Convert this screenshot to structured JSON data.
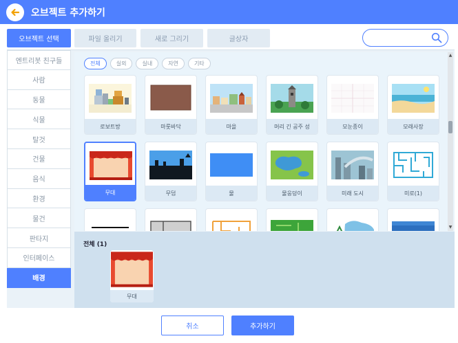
{
  "header": {
    "title": "오브젝트 추가하기"
  },
  "tabs": [
    {
      "label": "오브젝트 선택",
      "active": true
    },
    {
      "label": "파일 올리기",
      "active": false
    },
    {
      "label": "새로 그리기",
      "active": false
    },
    {
      "label": "글상자",
      "active": false
    }
  ],
  "search": {
    "placeholder": "",
    "value": ""
  },
  "sidebar": {
    "items": [
      {
        "label": "엔트리봇 친구들"
      },
      {
        "label": "사람"
      },
      {
        "label": "동물"
      },
      {
        "label": "식물"
      },
      {
        "label": "탈것"
      },
      {
        "label": "건물"
      },
      {
        "label": "음식"
      },
      {
        "label": "환경"
      },
      {
        "label": "물건"
      },
      {
        "label": "판타지"
      },
      {
        "label": "인터페이스"
      },
      {
        "label": "배경",
        "active": true
      }
    ]
  },
  "filters": [
    {
      "label": "전체",
      "active": true
    },
    {
      "label": "실외"
    },
    {
      "label": "실내"
    },
    {
      "label": "자연"
    },
    {
      "label": "기타"
    }
  ],
  "grid": {
    "items": [
      {
        "label": "로보트방",
        "icon": "robot-room-thumbnail"
      },
      {
        "label": "마룻바닥",
        "icon": "wood-floor-thumbnail"
      },
      {
        "label": "마을",
        "icon": "village-thumbnail"
      },
      {
        "label": "머리 긴 공주 성",
        "icon": "tower-thumbnail"
      },
      {
        "label": "모눈종이",
        "icon": "grid-paper-thumbnail"
      },
      {
        "label": "모래사장",
        "icon": "beach-thumbnail"
      },
      {
        "label": "무대",
        "icon": "stage-thumbnail",
        "selected": true
      },
      {
        "label": "무덤",
        "icon": "graveyard-thumbnail"
      },
      {
        "label": "물",
        "icon": "water-thumbnail"
      },
      {
        "label": "물웅덩이",
        "icon": "puddle-thumbnail"
      },
      {
        "label": "미래 도시",
        "icon": "future-city-thumbnail"
      },
      {
        "label": "미로(1)",
        "icon": "maze-thumbnail"
      },
      {
        "label": "",
        "icon": "line-thumbnail"
      },
      {
        "label": "",
        "icon": "room-plan-thumbnail"
      },
      {
        "label": "",
        "icon": "orange-maze-thumbnail"
      },
      {
        "label": "",
        "icon": "green-maze-thumbnail"
      },
      {
        "label": "",
        "icon": "island-thumbnail"
      },
      {
        "label": "",
        "icon": "sea-thumbnail"
      }
    ]
  },
  "selected": {
    "title": "전체 (1)",
    "items": [
      {
        "label": "무대",
        "icon": "stage-thumbnail"
      }
    ]
  },
  "footer": {
    "cancel_label": "취소",
    "add_label": "추가하기"
  },
  "colors": {
    "accent": "#4f80ff",
    "panel": "#eaf2f8",
    "selected_area": "#cfe0ee"
  }
}
